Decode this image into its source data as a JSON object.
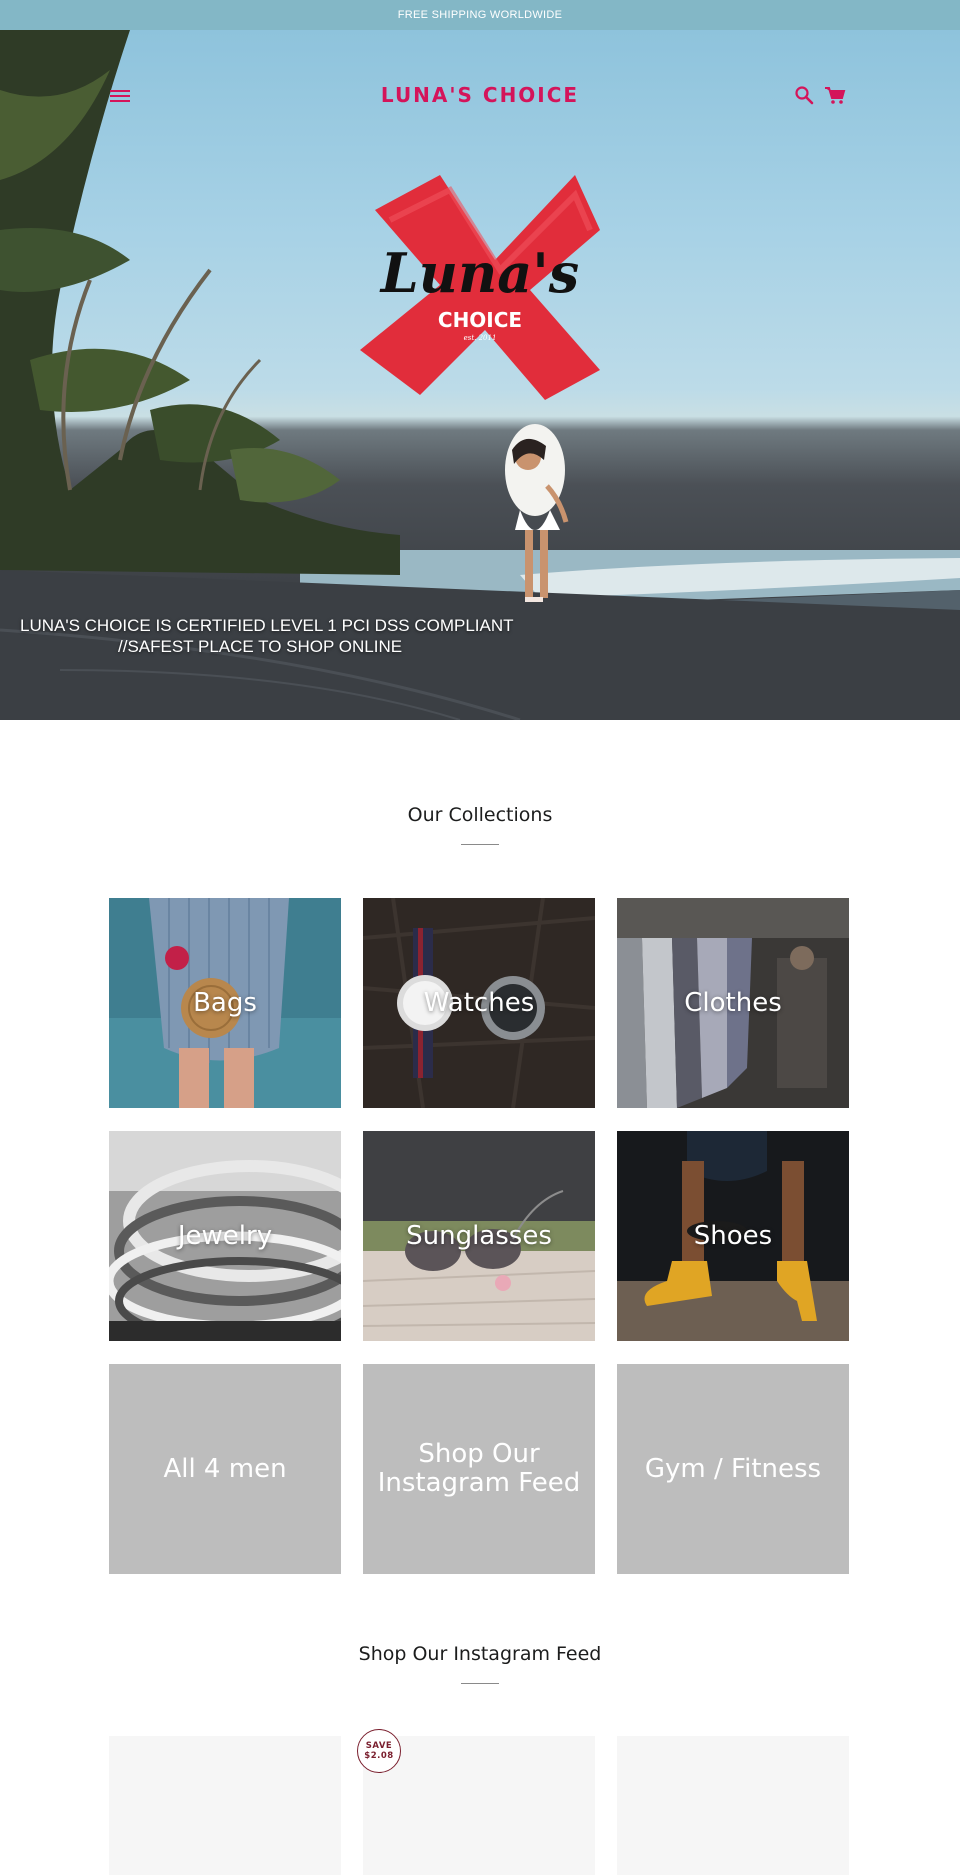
{
  "announcement": {
    "text": "FREE SHIPPING WORLDWIDE"
  },
  "header": {
    "title": "LUNA'S CHOICE",
    "menu_icon": "hamburger-menu-icon",
    "search_icon": "search-icon",
    "cart_icon": "cart-icon"
  },
  "hero": {
    "logo": {
      "word": "Luna's",
      "sub": "CHOICE",
      "est": "est. 2011"
    },
    "caption_line1": "LUNA'S CHOICE IS CERTIFIED LEVEL 1 PCI DSS COMPLIANT",
    "caption_line2": "//SAFEST PLACE TO SHOP ONLINE",
    "slides": {
      "count": 4,
      "active": 1
    }
  },
  "collections": {
    "title": "Our Collections",
    "items": [
      {
        "label": "Bags"
      },
      {
        "label": "Watches"
      },
      {
        "label": "Clothes"
      },
      {
        "label": "Jewelry"
      },
      {
        "label": "Sunglasses"
      },
      {
        "label": "Shoes"
      },
      {
        "label": "All 4 men"
      },
      {
        "label": "Shop Our Instagram Feed"
      },
      {
        "label": "Gym / Fitness"
      }
    ]
  },
  "instagram": {
    "title": "Shop Our Instagram Feed",
    "badge_line1": "SAVE",
    "badge_line2": "$2.08"
  },
  "colors": {
    "accent": "#d4145a",
    "announcement_bg": "#83b7c6",
    "tile_placeholder": "#bdbdbd",
    "badge": "#7a1f2e"
  }
}
